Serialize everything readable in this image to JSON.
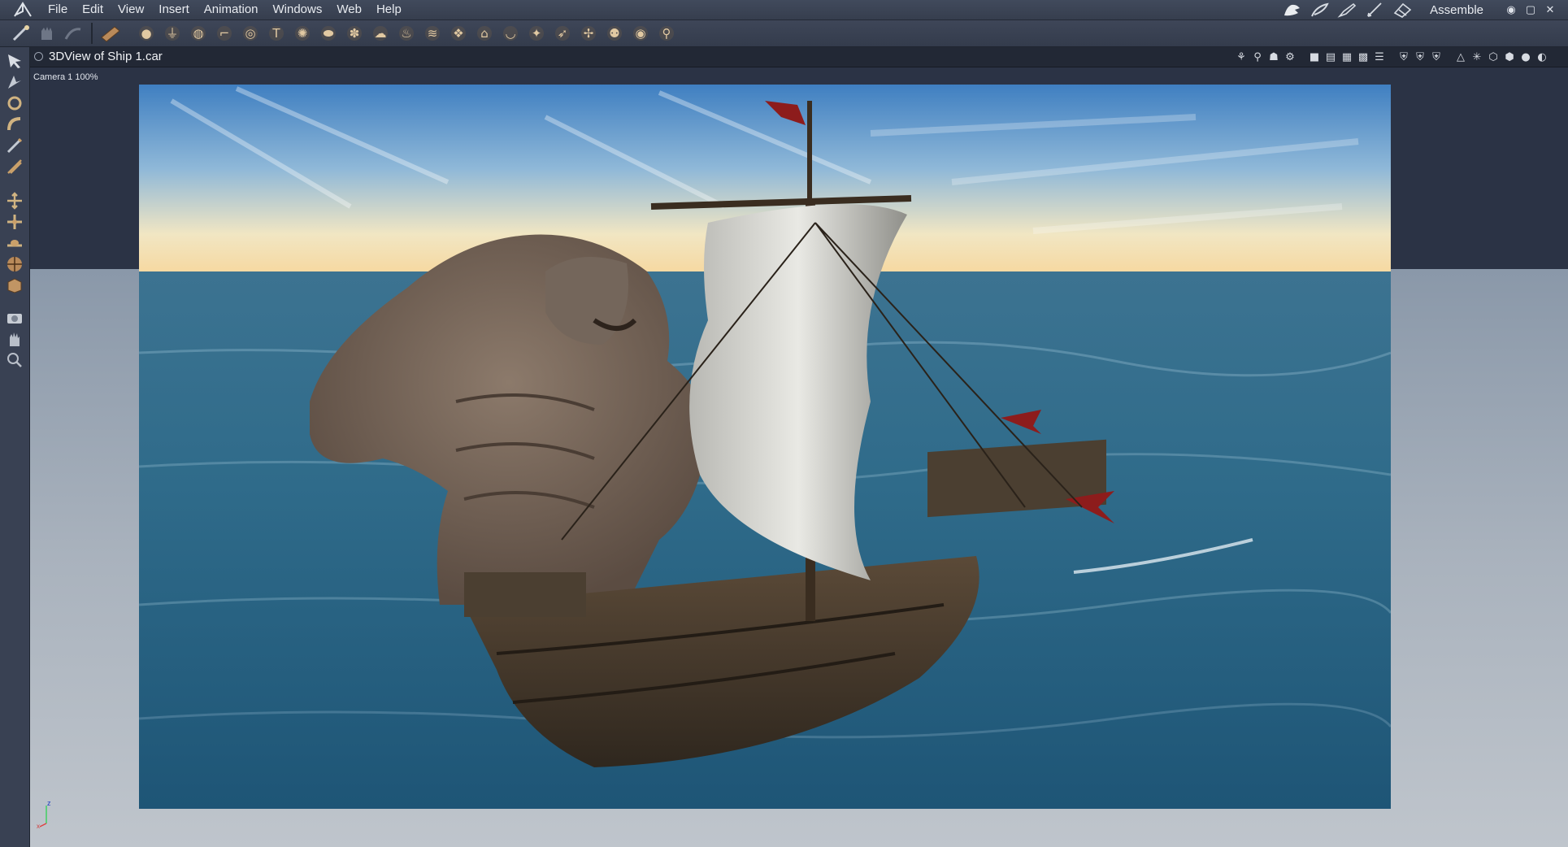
{
  "app": {
    "logo": "poser-figure-logo",
    "menus": [
      "File",
      "Edit",
      "View",
      "Insert",
      "Animation",
      "Windows",
      "Web",
      "Help"
    ],
    "mode_label": "Assemble",
    "mode_icons": [
      "hand-icon",
      "feather-icon",
      "brush-icon",
      "pen-icon",
      "eraser-icon"
    ]
  },
  "toolbar": {
    "main_tools": [
      "wand-icon",
      "hand-icon",
      "sweep-icon",
      "ruler-icon"
    ],
    "insert_tools": [
      "sphere-icon",
      "lathe-icon",
      "globe-icon",
      "figure-icon",
      "torus-icon",
      "text-icon",
      "gear-icon",
      "terrain-icon",
      "plant-icon",
      "cloud-icon",
      "fire-icon",
      "ocean-icon",
      "rock-icon",
      "house-icon",
      "bowl-icon",
      "sculpt-icon",
      "wing-icon",
      "particle-icon",
      "skeleton-icon",
      "target-icon",
      "bone-icon"
    ]
  },
  "left_tools": [
    "select-arrow-icon",
    "direct-select-icon",
    "rotate-icon",
    "bend-icon",
    "pencil-icon",
    "knife-icon",
    "move-icon",
    "scale-icon",
    "rotate-axis-icon",
    "trackball-icon",
    "box-icon",
    "camera-icon",
    "hand-icon",
    "zoom-icon"
  ],
  "viewport": {
    "title": "3DView of Ship 1.car",
    "camera_label": "Camera 1 100%",
    "controls": [
      "tree-icon",
      "figure-icon",
      "group-icon",
      "network-icon",
      "layout-single-icon",
      "layout-two-icon",
      "layout-four-icon",
      "layout-grid-icon",
      "layout-list-icon",
      "shield-icon",
      "shield-icon",
      "shield-icon",
      "cone-icon",
      "snowflake-icon",
      "cube-wire-icon",
      "cube-solid-icon",
      "sphere-shaded-icon",
      "sphere-render-icon"
    ]
  },
  "render": {
    "description_icons": [
      "sky",
      "ocean",
      "sea-monster",
      "sailing-ship"
    ]
  },
  "axis": {
    "z_label": "z",
    "x_label": "x"
  }
}
